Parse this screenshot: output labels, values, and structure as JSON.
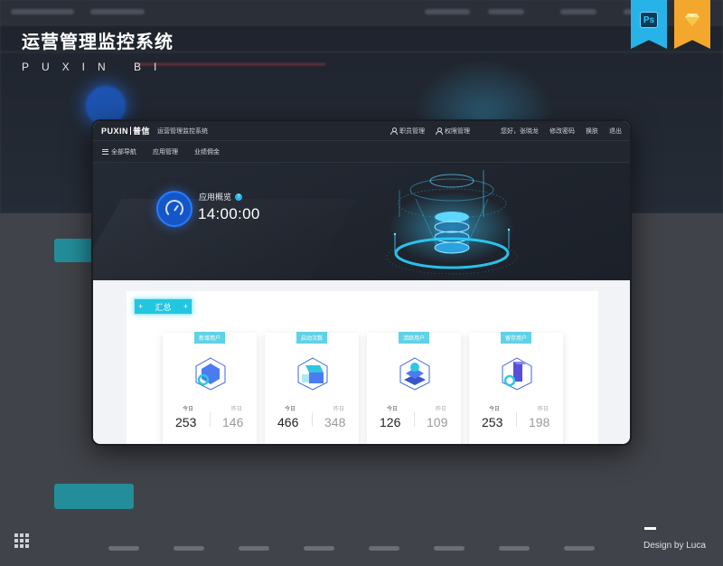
{
  "brand": {
    "title": "运营管理监控系统",
    "subtitle": "PUXIN BI"
  },
  "badges": {
    "ps": "Ps",
    "sketch": "◆"
  },
  "signature": "Design by Luca",
  "app": {
    "logo_text": "PUXIN",
    "logo_cn": "普信",
    "system_name": "运营管理监控系统",
    "links": {
      "role": "职员管理",
      "permission": "权限管理",
      "greeting": "您好，张晓龙",
      "change_password": "修改密码",
      "skin": "换肤",
      "logout": "退出"
    },
    "nav": {
      "all": "全部导航",
      "app_manage": "应用管理",
      "commission": "业绩佣金"
    },
    "hero": {
      "title": "应用概览",
      "help": "?",
      "time": "14:00:00"
    },
    "summary": {
      "label": "汇总",
      "left": "+",
      "right": "+"
    },
    "stats": [
      {
        "tag": "新增用户",
        "today_label": "今日",
        "yesterday_label": "昨日",
        "today": "253",
        "yesterday": "146"
      },
      {
        "tag": "启动次数",
        "today_label": "今日",
        "yesterday_label": "昨日",
        "today": "466",
        "yesterday": "348"
      },
      {
        "tag": "活跃用户",
        "today_label": "今日",
        "yesterday_label": "昨日",
        "today": "126",
        "yesterday": "109"
      },
      {
        "tag": "留存用户",
        "today_label": "今日",
        "yesterday_label": "昨日",
        "today": "253",
        "yesterday": "198"
      }
    ]
  },
  "colors": {
    "accent": "#23c6e0",
    "dark": "#21262f",
    "blue": "#1456c8"
  }
}
